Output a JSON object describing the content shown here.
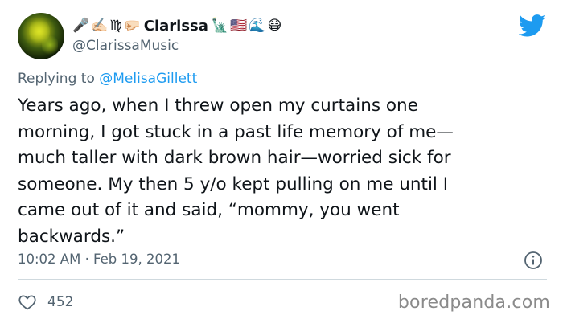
{
  "author": {
    "name_prefix_emojis": [
      "🎤",
      "✍🏻",
      "♍",
      "🤛🏻"
    ],
    "display_name": "Clarissa",
    "name_suffix_emojis": [
      "🗽",
      "🇺🇸",
      "🌊",
      "😷"
    ],
    "handle": "@ClarissaMusic"
  },
  "reply_to": {
    "prefix": "Replying to ",
    "handle": "@MelisaGillett"
  },
  "tweet": {
    "text": "Years ago, when I threw open my curtains one\nmorning, I got stuck in a past life memory of me—\nmuch taller with dark brown hair—worried sick for\nsomeone. My then 5 y/o kept pulling on me until I\ncame out of it and said, “mommy, you went\nbackwards.”",
    "timestamp": "10:02 AM · Feb 19, 2021",
    "likes": "452"
  },
  "watermark": "boredpanda.com",
  "colors": {
    "twitter_blue": "#1d9bf0",
    "text": "#0f1419",
    "secondary": "#536471",
    "divider": "#cfd9de"
  },
  "icons": {
    "brand": "twitter-bird-icon",
    "info": "info-icon",
    "like": "heart-icon"
  }
}
